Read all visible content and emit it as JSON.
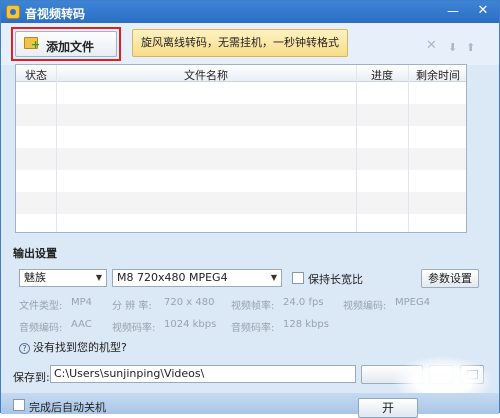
{
  "window": {
    "title": "音视频转码"
  },
  "titlebar": {
    "minimize": "—",
    "close": "✕"
  },
  "toolbar": {
    "add_file_label": "添加文件",
    "promo_label": "旋风离线转码，无需挂机，一秒钟转格式",
    "icons": [
      "close-icon",
      "arrow-down-icon",
      "arrow-up-icon"
    ]
  },
  "table": {
    "columns": [
      "状态",
      "文件名称",
      "进度",
      "剩余时间"
    ],
    "rows": []
  },
  "output": {
    "title": "输出设置",
    "brand": "魅族",
    "model": "M8 720x480 MPEG4",
    "keep_ratio_label": "保持长宽比",
    "keep_ratio_checked": false,
    "params_button": "参数设置",
    "specs": {
      "file_type_label": "文件类型:",
      "file_type_value": "MP4",
      "resolution_label": "分 辨 率:",
      "resolution_value": "720 x 480",
      "frame_rate_label": "视频帧率:",
      "frame_rate_value": "24.0 fps",
      "video_codec_label": "视频编码:",
      "video_codec_value": "MPEG4",
      "audio_codec_label": "音频编码:",
      "audio_codec_value": "AAC",
      "video_bitrate_label": "视频码率:",
      "video_bitrate_value": "1024 kbps",
      "audio_bitrate_label": "音频码率:",
      "audio_bitrate_value": "128 kbps"
    },
    "help_text": "没有找到您的机型?"
  },
  "save": {
    "label": "保存到:",
    "path": "C:\\Users\\sunjinping\\Videos\\"
  },
  "footer": {
    "shutdown_label": "完成后自动关机",
    "shutdown_checked": false,
    "start_button": "开"
  },
  "colors": {
    "title_bar": "#2f74c8",
    "window_bg": "#dbe8f6",
    "highlight": "#e02020",
    "promo_bg": "#f7dc8a"
  }
}
